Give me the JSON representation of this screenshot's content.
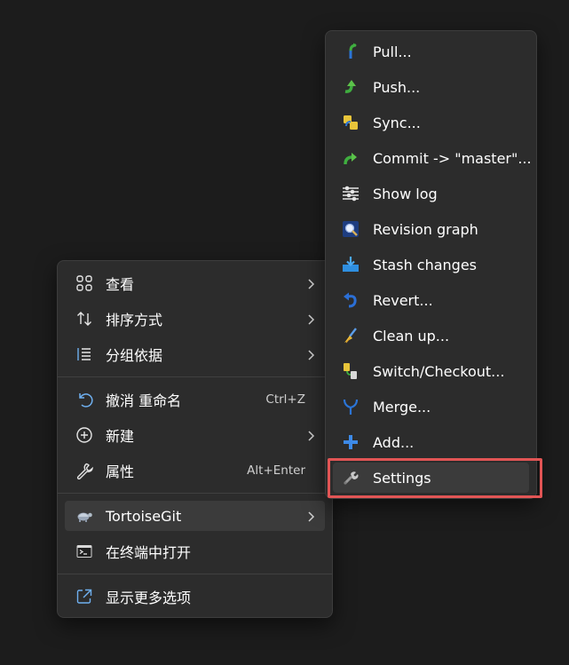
{
  "main_menu": {
    "items": [
      {
        "label": "查看",
        "icon": "view-grid-icon"
      },
      {
        "label": "排序方式",
        "icon": "sort-icon"
      },
      {
        "label": "分组依据",
        "icon": "group-by-icon"
      },
      {
        "label": "撤消 重命名",
        "icon": "undo-icon",
        "shortcut": "Ctrl+Z"
      },
      {
        "label": "新建",
        "icon": "new-plus-icon"
      },
      {
        "label": "属性",
        "icon": "wrench-icon",
        "shortcut": "Alt+Enter"
      },
      {
        "label": "TortoiseGit",
        "icon": "tortoisegit-icon"
      },
      {
        "label": "在终端中打开",
        "icon": "terminal-icon"
      },
      {
        "label": "显示更多选项",
        "icon": "show-more-options-icon"
      }
    ]
  },
  "submenu": {
    "items": [
      {
        "label": "Pull...",
        "icon": "pull-icon"
      },
      {
        "label": "Push...",
        "icon": "push-icon"
      },
      {
        "label": "Sync...",
        "icon": "sync-icon"
      },
      {
        "label": "Commit -> \"master\"...",
        "icon": "commit-icon"
      },
      {
        "label": "Show log",
        "icon": "show-log-icon"
      },
      {
        "label": "Revision graph",
        "icon": "revision-graph-icon"
      },
      {
        "label": "Stash changes",
        "icon": "stash-icon"
      },
      {
        "label": "Revert...",
        "icon": "revert-icon"
      },
      {
        "label": "Clean up...",
        "icon": "cleanup-broom-icon"
      },
      {
        "label": "Switch/Checkout...",
        "icon": "switch-checkout-icon"
      },
      {
        "label": "Merge...",
        "icon": "merge-icon"
      },
      {
        "label": "Add...",
        "icon": "add-plus-icon"
      },
      {
        "label": "Settings",
        "icon": "settings-wrench-icon"
      }
    ]
  },
  "colors": {
    "menu_bg": "#2c2c2c",
    "hover_bg": "#3b3b3b",
    "highlight_border": "#e25555",
    "accent_blue": "#5aa0e8"
  }
}
